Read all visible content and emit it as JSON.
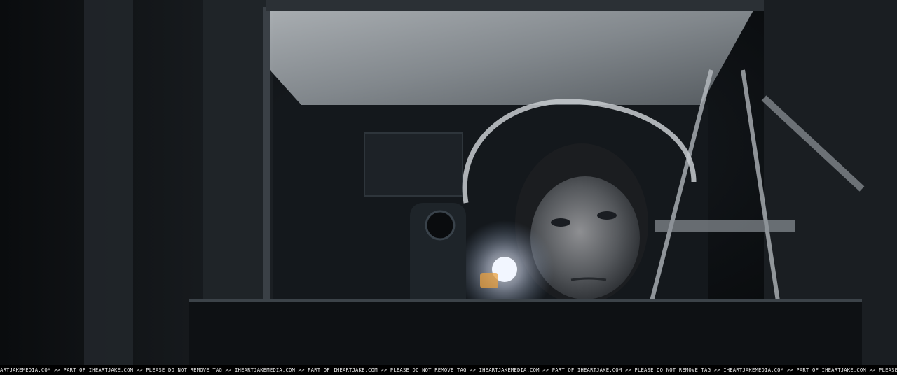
{
  "image": {
    "description_free": true,
    "watermark": {
      "text": "ARTJAKEMEDIA.COM >> PART OF IHEARTJAKE.COM >> PLEASE DO NOT REMOVE TAG >> IHEARTJAKEMEDIA.COM >> PART OF IHEARTJAKE.COM >> PLEASE DO NOT REMOVE TAG >> IHEARTJAKEMEDIA.COM >> PART OF IHEARTJAKE.COM >> PLEASE DO NOT REMOVE TAG >> IHEARTJAKEMEDIA.COM >> PART OF IHEARTJAKE.COM >> PLEASE"
    },
    "colors": {
      "background": "#07090b",
      "metal_panel": "#9da3a8",
      "light_glow": "#f2f6ff",
      "warm_flare": "#e8a040",
      "watermark_text": "#e9e9e9"
    }
  }
}
